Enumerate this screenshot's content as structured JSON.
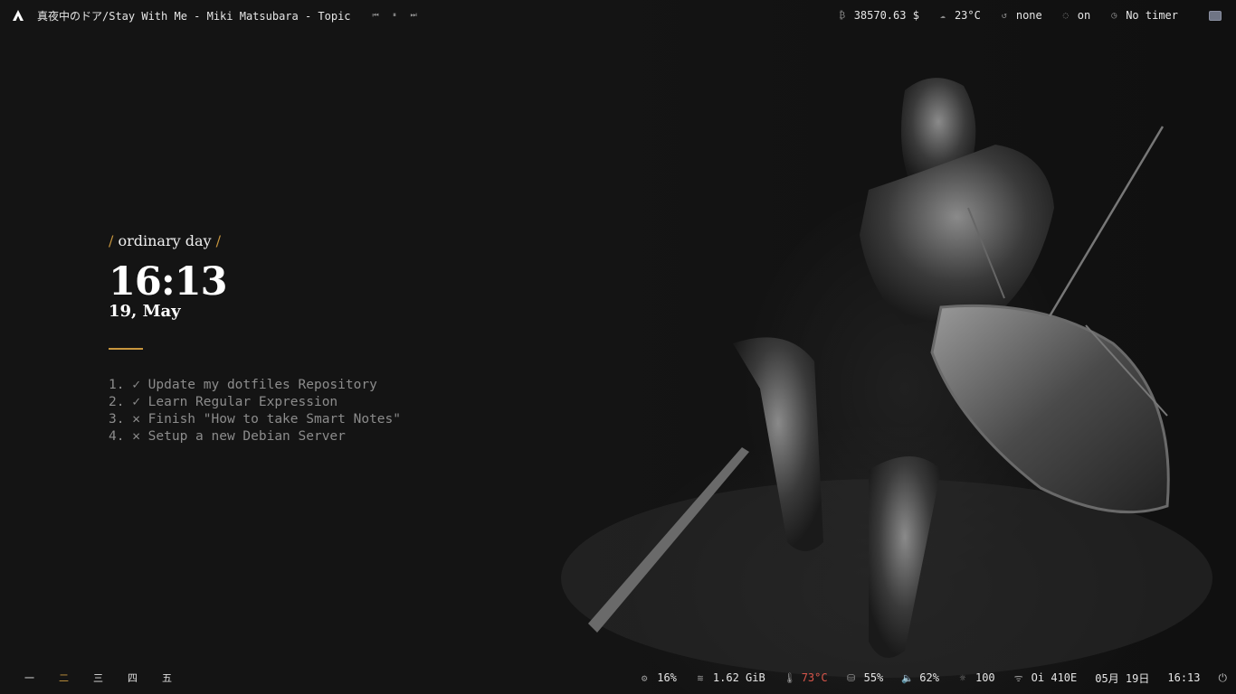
{
  "topbar": {
    "media_title": "真夜中のドア/Stay With Me - Miki Matsubara - Topic",
    "media_controls": [
      {
        "icon": "skip-previous-icon",
        "glyph": "⏮"
      },
      {
        "icon": "pause-icon",
        "glyph": "⏸"
      },
      {
        "icon": "skip-next-icon",
        "glyph": "⏭"
      }
    ],
    "bitcoin": {
      "icon": "bitcoin-icon",
      "glyph": "₿",
      "value": "38570.63 $"
    },
    "weather": {
      "icon": "cloud-icon",
      "glyph": "☁",
      "value": "23°C"
    },
    "timer_mode": {
      "icon": "history-icon",
      "glyph": "↺",
      "value": "none"
    },
    "caffeine": {
      "icon": "lightbulb-icon",
      "glyph": "◌",
      "value": "on"
    },
    "timer": {
      "icon": "stopwatch-icon",
      "glyph": "◷",
      "value": "No timer"
    },
    "tray_icon": "tray-window-icon"
  },
  "widget": {
    "greeting": "ordinary day",
    "slash": "/",
    "time": "16:13",
    "date": "19, May",
    "todos": [
      "1. ✓ Update my dotfiles Repository",
      "2. ✓ Learn Regular Expression",
      "3. ✕ Finish \"How to take Smart Notes\"",
      "4. ✕ Setup a new Debian Server"
    ]
  },
  "bottombar": {
    "workspaces": [
      {
        "label": "一",
        "active": false
      },
      {
        "label": "二",
        "active": true
      },
      {
        "label": "三",
        "active": false
      },
      {
        "label": "四",
        "active": false
      },
      {
        "label": "五",
        "active": false
      }
    ],
    "cpu": {
      "icon": "cog-icon",
      "glyph": "⚙",
      "value": "16%"
    },
    "memory": {
      "icon": "layers-icon",
      "glyph": "≋",
      "value": "1.62 GiB"
    },
    "temperature": {
      "icon": "thermometer-icon",
      "glyph": "🌡",
      "value": "73°C"
    },
    "disk": {
      "icon": "harddisk-icon",
      "glyph": "⛁",
      "value": "55%"
    },
    "volume": {
      "icon": "speaker-icon",
      "glyph": "🔈",
      "value": "62%"
    },
    "brightness": {
      "icon": "brightness-icon",
      "glyph": "☼",
      "value": "100"
    },
    "network": {
      "icon": "wifi-icon",
      "glyph": "ᯤ",
      "value": "Oi 410E"
    },
    "date": "05月 19日",
    "time": "16:13",
    "power": {
      "icon": "power-icon",
      "glyph": "⏻"
    }
  },
  "colors": {
    "accent": "#c8963e",
    "background": "#121212",
    "warning": "#d8554a",
    "todo_text": "#8c8c8c"
  }
}
